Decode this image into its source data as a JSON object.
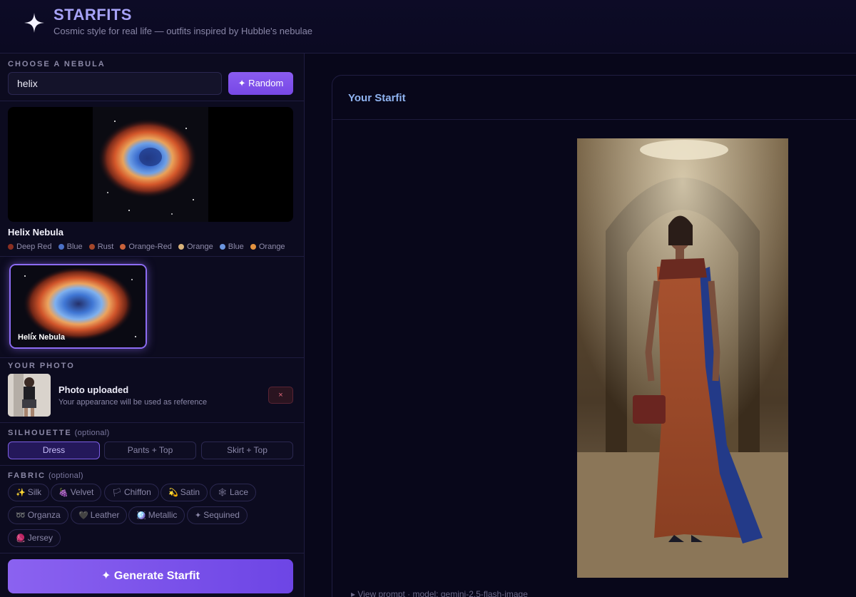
{
  "header": {
    "brand": "STARFITS",
    "tagline": "Cosmic style for real life — outfits inspired by Hubble's nebulae"
  },
  "nebula": {
    "section_title": "CHOOSE A NEBULA",
    "search_value": "helix",
    "random_label": "✦ Random",
    "selected_name": "Helix Nebula",
    "palette": [
      {
        "label": "Deep Red",
        "color": "#8a2f22"
      },
      {
        "label": "Blue",
        "color": "#4a6fc4"
      },
      {
        "label": "Rust",
        "color": "#a4472a"
      },
      {
        "label": "Orange-Red",
        "color": "#c9623b"
      },
      {
        "label": "Orange",
        "color": "#d8b27a"
      },
      {
        "label": "Blue",
        "color": "#6b95e0"
      },
      {
        "label": "Orange",
        "color": "#e39240"
      }
    ],
    "thumbnail_label": "Helix Nebula"
  },
  "photo": {
    "section_title": "YOUR PHOTO",
    "status_title": "Photo uploaded",
    "status_sub": "Your appearance will be used as reference",
    "remove_label": "×"
  },
  "silhouette": {
    "section_title": "SILHOUETTE",
    "optional": "(optional)",
    "options": [
      "Dress",
      "Pants + Top",
      "Skirt + Top"
    ],
    "selected": "Dress"
  },
  "fabric": {
    "section_title": "FABRIC",
    "optional": "(optional)",
    "options": [
      {
        "icon": "✨",
        "label": "Silk"
      },
      {
        "icon": "🍇",
        "label": "Velvet"
      },
      {
        "icon": "🏳",
        "label": "Chiffon"
      },
      {
        "icon": "💫",
        "label": "Satin"
      },
      {
        "icon": "🕸",
        "label": "Lace"
      },
      {
        "icon": "➿",
        "label": "Organza"
      },
      {
        "icon": "🖤",
        "label": "Leather"
      },
      {
        "icon": "🪩",
        "label": "Metallic"
      },
      {
        "icon": "✦",
        "label": "Sequined"
      },
      {
        "icon": "🧶",
        "label": "Jersey"
      }
    ]
  },
  "generate_label": "✦  Generate Starfit",
  "result": {
    "title": "Your Starfit",
    "view_prompt": "▸ View prompt · model: gemini-2.5-flash-image"
  }
}
